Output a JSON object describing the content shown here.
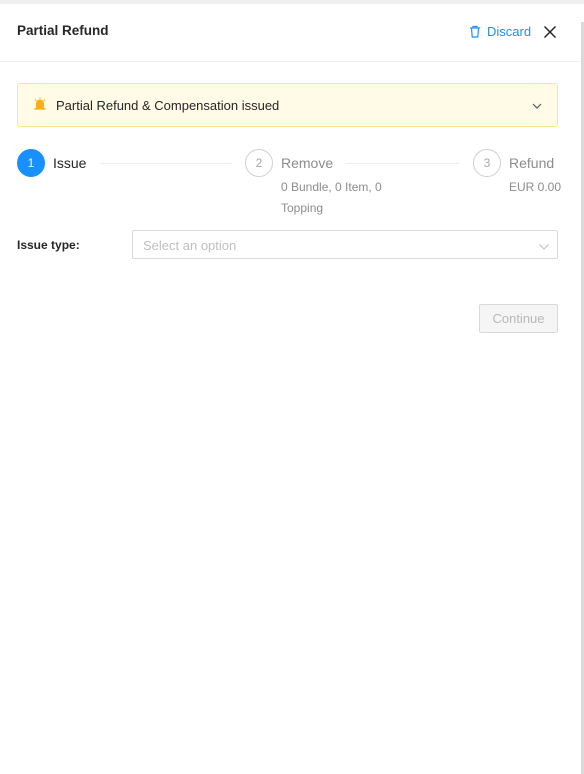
{
  "header": {
    "title": "Partial Refund",
    "discard_label": "Discard",
    "icons": {
      "discard": "trash-icon",
      "close": "close-icon"
    }
  },
  "alert": {
    "text": "Partial Refund & Compensation issued",
    "icons": {
      "leading": "alarm-bell-icon",
      "trailing": "chevron-down-icon"
    }
  },
  "steps": [
    {
      "number": "1",
      "title": "Issue",
      "description": "",
      "status": "active"
    },
    {
      "number": "2",
      "title": "Remove",
      "description_lines": [
        "0 Bundle, 0 Item, 0",
        "Topping"
      ],
      "status": "waiting"
    },
    {
      "number": "3",
      "title": "Refund",
      "description": "EUR 0.00",
      "status": "waiting"
    }
  ],
  "form": {
    "issue_type_label": "Issue type:",
    "issue_type_placeholder": "Select an option",
    "continue_label": "Continue"
  },
  "colors": {
    "accent": "#1890ff",
    "alert_bg": "#fffbe6",
    "alert_border": "#ffe58f",
    "bell": "#faad14"
  }
}
